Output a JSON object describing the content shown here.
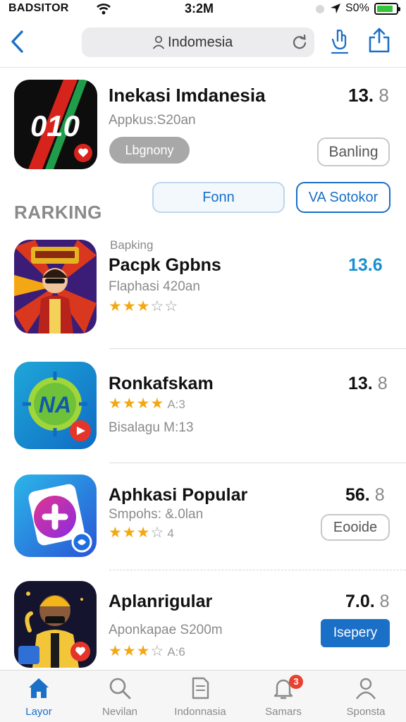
{
  "status_bar": {
    "carrier": "BADSITOR",
    "time": "3:2M",
    "battery_pct": "S0%",
    "battery_level": 0.8
  },
  "nav": {
    "search_text": "Indomesia"
  },
  "featured": {
    "title": "Inekasi Imdanesia",
    "subtitle": "Appkus:S20an",
    "score_main": "13.",
    "score_dim": "8",
    "pill_label": "Lbgnony",
    "button_label": "Banling",
    "icon_text": "010"
  },
  "actions": {
    "fonn_label": "Fonn",
    "sotokor_label": "VA Sotokor"
  },
  "section_title": "RARKING",
  "rankings": [
    {
      "kicker": "Bapking",
      "title": "Pacpk Gpbns",
      "subtitle": "Flaphasi 420an",
      "score": "13.6",
      "rating": 3,
      "rating_max": 5,
      "rating_text": ""
    },
    {
      "title": "Ronkafskam",
      "subtitle": "Bisalagu M:13",
      "score_main": "13.",
      "score_dim": "8",
      "rating": 4,
      "rating_max": 4,
      "rating_text": "A:3"
    },
    {
      "title": "Aphkasi Popular",
      "subtitle": "Smpohs: &.0lan",
      "score_main": "56.",
      "score_dim": "8",
      "rating": 3,
      "rating_max": 4,
      "rating_text": "4",
      "button_label": "Eooide"
    },
    {
      "title": "Aplanrigular",
      "subtitle": "Aponkapae S200m",
      "score_main": "7.0.",
      "score_dim": "8",
      "rating": 3,
      "rating_max": 4,
      "rating_text": "A:6",
      "button_label": "Isepery"
    }
  ],
  "tabs": [
    {
      "label": "Layor",
      "active": true
    },
    {
      "label": "Nevilan",
      "active": false
    },
    {
      "label": "Indonnasia",
      "active": false
    },
    {
      "label": "Samars",
      "active": false,
      "badge": "3"
    },
    {
      "label": "Sponsta",
      "active": false
    }
  ],
  "colors": {
    "accent": "#1a6fc7",
    "star": "#f3a712",
    "badge": "#e7412f"
  }
}
